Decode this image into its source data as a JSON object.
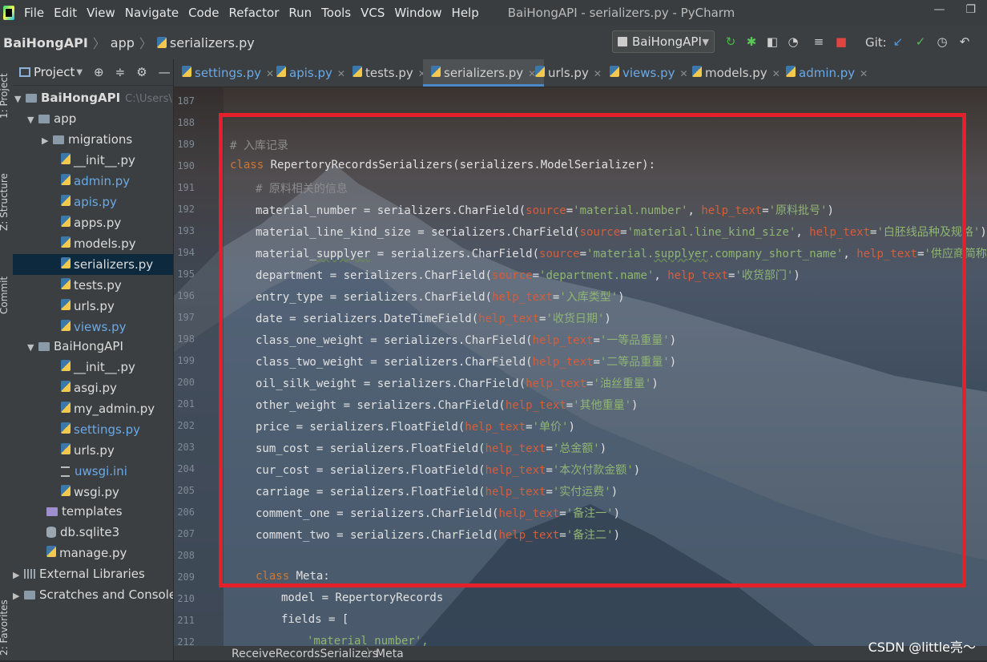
{
  "menubar": {
    "items": [
      "File",
      "Edit",
      "View",
      "Navigate",
      "Code",
      "Refactor",
      "Run",
      "Tools",
      "VCS",
      "Window",
      "Help"
    ],
    "window_title": "BaiHongAPI - serializers.py - PyCharm"
  },
  "navbar": {
    "project": "BaiHongAPI",
    "folder": "app",
    "file": "serializers.py",
    "run_config": "BaiHongAPI",
    "git_label": "Git:"
  },
  "side_tabs": {
    "project": "1: Project",
    "structure": "Z: Structure",
    "commit": "Commit",
    "favorites": "2: Favorites"
  },
  "project_panel": {
    "title": "Project",
    "root": "BaiHongAPI",
    "root_path": "C:\\Users\\LLL",
    "app_folder": "app",
    "migrations": "migrations",
    "app_files": [
      "__init__.py",
      "admin.py",
      "apis.py",
      "apps.py",
      "models.py",
      "serializers.py",
      "tests.py",
      "urls.py",
      "views.py"
    ],
    "pkg_folder": "BaiHongAPI",
    "pkg_files": [
      "__init__.py",
      "asgi.py",
      "my_admin.py",
      "settings.py",
      "urls.py",
      "uwsgi.ini",
      "wsgi.py"
    ],
    "templates": "templates",
    "db": "db.sqlite3",
    "manage": "manage.py",
    "external_libraries": "External Libraries",
    "scratches": "Scratches and Consoles"
  },
  "tabs": [
    "settings.py",
    "apis.py",
    "tests.py",
    "serializers.py",
    "urls.py",
    "views.py",
    "models.py",
    "admin.py"
  ],
  "editor": {
    "line_numbers": [
      "187",
      "188",
      "189",
      "190",
      "191",
      "192",
      "193",
      "194",
      "195",
      "196",
      "197",
      "198",
      "199",
      "200",
      "201",
      "202",
      "203",
      "204",
      "205",
      "206",
      "207",
      "208",
      "209",
      "210",
      "211",
      "212"
    ],
    "breadcrumb": [
      "ReceiveRecordsSerializers",
      "Meta"
    ]
  },
  "code": {
    "comment_record": "# 入库记录",
    "kw_class": "class",
    "class_sig": " RepertoryRecordsSerializers(serializers.ModelSerializer):",
    "comment_material": "# 原料相关的信息",
    "material_number": {
      "pre": "material_number = serializers.CharField(",
      "p1": "source",
      "s1": "'material.number'",
      "p2": "help_text",
      "s2": "'原料批号'",
      "end": ")"
    },
    "material_line": {
      "pre": "material_line_kind_size = serializers.CharField(",
      "p1": "source",
      "s1": "'material.line_kind_size'",
      "p2": "help_text",
      "s2": "'白胚线品种及规格'",
      "end": ")"
    },
    "material_supplyer": {
      "pre1": "material_",
      "pre2": "supplyer",
      "pre3": " = serializers.CharField(",
      "p1": "source",
      "s1a": "'material.",
      "s1b": "supplyer",
      "s1c": ".company_short_name'",
      "p2": "help_text",
      "s2": "'供应商简称'",
      "end": ")"
    },
    "department": {
      "pre": "department = serializers.CharField(",
      "p1": "source",
      "s1": "'department.name'",
      "p2": "help_text",
      "s2": "'收货部门'",
      "end": ")"
    },
    "simple_lines": [
      {
        "pre": "entry_type = serializers.CharField(",
        "s": "'入库类型'"
      },
      {
        "pre": "date = serializers.DateTimeField(",
        "s": "'收货日期'"
      },
      {
        "pre": "class_one_weight = serializers.CharField(",
        "s": "'一等品重量'"
      },
      {
        "pre": "class_two_weight = serializers.CharField(",
        "s": "'二等品重量'"
      },
      {
        "pre": "oil_silk_weight = serializers.CharField(",
        "s": "'油丝重量'"
      },
      {
        "pre": "other_weight = serializers.CharField(",
        "s": "'其他重量'"
      },
      {
        "pre": "price = serializers.FloatField(",
        "s": "'单价'"
      },
      {
        "pre": "sum_cost = serializers.FloatField(",
        "s": "'总金额'"
      },
      {
        "pre": "cur_cost = serializers.FloatField(",
        "s": "'本次付款金额'"
      },
      {
        "pre": "carriage = serializers.FloatField(",
        "s": "'实付运费'"
      },
      {
        "pre": "comment_one = serializers.CharField(",
        "s": "'备注一'"
      },
      {
        "pre": "comment_two = serializers.CharField(",
        "s": "'备注二'"
      }
    ],
    "help_text": "help_text",
    "eq": "=",
    "close": ")",
    "meta_name": " Meta:",
    "model_line": "model = RepertoryRecords",
    "fields_line": "fields = [",
    "field_first": "'material_number',"
  },
  "watermark": "CSDN @little亮～"
}
